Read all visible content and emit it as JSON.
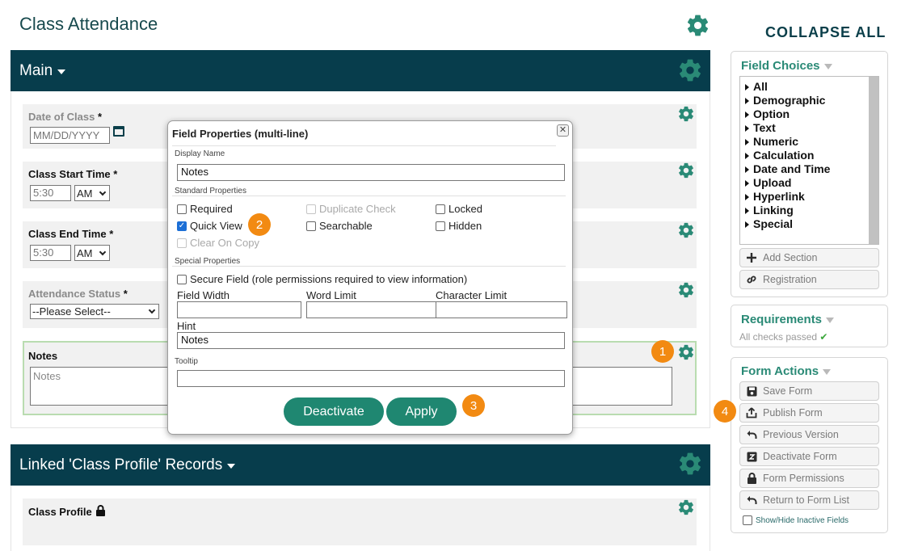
{
  "page": {
    "title": "Class Attendance",
    "collapse_all": "COLLAPSE ALL"
  },
  "main_section": {
    "title": "Main",
    "fields": {
      "date_of_class": {
        "label": "Date of Class",
        "required": "*",
        "placeholder": "MM/DD/YYYY"
      },
      "class_start_time": {
        "label": "Class Start Time",
        "required": "*",
        "time_value": "5:30",
        "ampm": "AM"
      },
      "class_end_time": {
        "label": "Class End Time",
        "required": "*",
        "time_value": "5:30",
        "ampm": "AM"
      },
      "attendance_status": {
        "label": "Attendance Status",
        "required": "*",
        "selected": "--Please Select--"
      },
      "notes": {
        "label": "Notes",
        "placeholder": "Notes"
      }
    }
  },
  "linked_section": {
    "title": "Linked 'Class Profile' Records",
    "field_label": "Class Profile"
  },
  "modal": {
    "title": "Field Properties (multi-line)",
    "close": "☒",
    "display_name_label": "Display Name",
    "display_name_value": "Notes",
    "standard_properties_label": "Standard Properties",
    "checkboxes": {
      "required": "Required",
      "duplicate_check": "Duplicate Check",
      "locked": "Locked",
      "quick_view": "Quick View",
      "searchable": "Searchable",
      "hidden": "Hidden",
      "clear_on_copy": "Clear On Copy"
    },
    "special_properties_label": "Special Properties",
    "secure_field": "Secure Field (role permissions required to view information)",
    "field_width_label": "Field Width",
    "word_limit_label": "Word Limit",
    "character_limit_label": "Character Limit",
    "hint_label": "Hint",
    "hint_value": "Notes",
    "tooltip_label": "Tooltip",
    "deactivate_button": "Deactivate",
    "apply_button": "Apply"
  },
  "sidebar": {
    "field_choices": {
      "title": "Field Choices",
      "items": [
        "All",
        "Demographic",
        "Option",
        "Text",
        "Numeric",
        "Calculation",
        "Date and Time",
        "Upload",
        "Hyperlink",
        "Linking",
        "Special"
      ],
      "add_section": "Add Section",
      "registration": "Registration"
    },
    "requirements": {
      "title": "Requirements",
      "status": "All checks passed",
      "check": "✔"
    },
    "form_actions": {
      "title": "Form Actions",
      "buttons": [
        "Save Form",
        "Publish Form",
        "Previous Version",
        "Deactivate Form",
        "Form Permissions",
        "Return to Form List"
      ],
      "show_hide": "Show/Hide Inactive Fields"
    }
  },
  "callouts": [
    "1",
    "2",
    "3",
    "4"
  ],
  "colors": {
    "header_bg": "#073d4c",
    "accent_green": "#2a8a76",
    "button_green": "#1f8771",
    "callout_orange": "#f28a12"
  }
}
